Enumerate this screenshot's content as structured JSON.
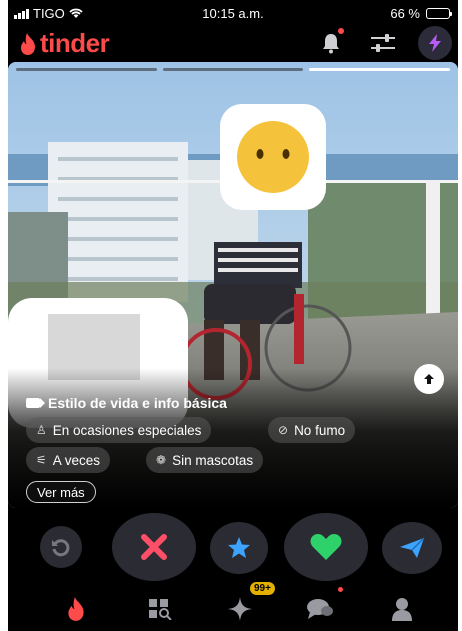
{
  "status_bar": {
    "carrier": "TIGO",
    "time": "10:15 a.m.",
    "battery": "66 %",
    "battery_level": 0.66
  },
  "header": {
    "logo_text": "tinder",
    "brand_color": "#fd4a4a",
    "icons": [
      "flame-icon",
      "bell-icon",
      "sliders-icon",
      "boost-icon"
    ]
  },
  "card": {
    "photo_count": 3,
    "active_photo": 3,
    "section_title": "Estilo de vida e info básica",
    "chips": [
      {
        "label": "En ocasiones especiales",
        "icon": "glass-icon"
      },
      {
        "label": "No fumo",
        "icon": "no-smoking-icon"
      },
      {
        "label": "A veces",
        "icon": "dumbbell-icon"
      },
      {
        "label": "Sin mascotas",
        "icon": "paw-icon"
      }
    ],
    "more_label": "Ver más"
  },
  "actions": {
    "rewind": {
      "icon": "rewind-icon",
      "color": "#f5b748"
    },
    "nope": {
      "icon": "close-icon",
      "color": "#fd5068"
    },
    "super_like": {
      "icon": "star-icon",
      "color": "#3ca4ff"
    },
    "like": {
      "icon": "heart-icon",
      "color": "#1be4a1"
    },
    "boost": {
      "icon": "send-icon",
      "color": "#3ca4ff"
    }
  },
  "nav": {
    "items": [
      "flame-icon",
      "explore-icon",
      "likes-icon",
      "chat-icon",
      "profile-icon"
    ],
    "likes_badge": "99+"
  }
}
